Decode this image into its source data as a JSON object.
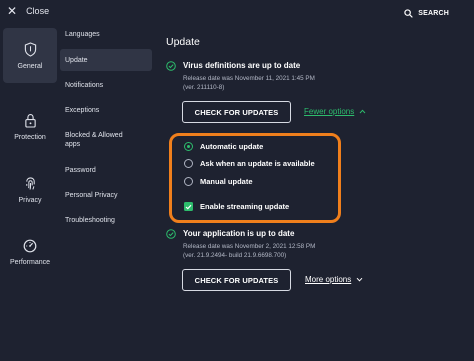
{
  "topbar": {
    "close_label": "Close",
    "close_icon": "close-icon",
    "search_label": "SEARCH",
    "search_icon": "search-icon"
  },
  "leftnav": {
    "items": [
      {
        "label": "General",
        "icon": "shield-icon",
        "active": true
      },
      {
        "label": "Protection",
        "icon": "lock-icon",
        "active": false
      },
      {
        "label": "Privacy",
        "icon": "fingerprint-icon",
        "active": false
      },
      {
        "label": "Performance",
        "icon": "speedometer-icon",
        "active": false
      }
    ]
  },
  "subnav": {
    "items": [
      {
        "label": "Languages",
        "active": false
      },
      {
        "label": "Update",
        "active": true
      },
      {
        "label": "Notifications",
        "active": false
      },
      {
        "label": "Exceptions",
        "active": false
      },
      {
        "label": "Blocked & Allowed apps",
        "active": false
      },
      {
        "label": "Password",
        "active": false
      },
      {
        "label": "Personal Privacy",
        "active": false
      },
      {
        "label": "Troubleshooting",
        "active": false
      }
    ]
  },
  "main": {
    "title": "Update",
    "definitions": {
      "status": "Virus definitions are up to date",
      "release": "Release date was November 11, 2021 1:45 PM",
      "version": "(ver. 211110-8)",
      "button": "CHECK FOR UPDATES",
      "link": "Fewer options"
    },
    "options": [
      {
        "label": "Automatic update",
        "type": "radio",
        "selected": true
      },
      {
        "label": "Ask when an update is available",
        "type": "radio",
        "selected": false
      },
      {
        "label": "Manual update",
        "type": "radio",
        "selected": false
      },
      {
        "label": "Enable streaming update",
        "type": "checkbox",
        "selected": true
      }
    ],
    "application": {
      "status": "Your application is up to date",
      "release": "Release date was November 2, 2021 12:58 PM",
      "version": "(ver. 21.9.2494- build 21.9.6698.700)",
      "button": "CHECK FOR UPDATES",
      "link": "More options"
    }
  },
  "colors": {
    "background": "#1e2230",
    "accent_green": "#2dbc6c",
    "highlight_orange": "#f07f1c",
    "active_item": "#303545"
  }
}
